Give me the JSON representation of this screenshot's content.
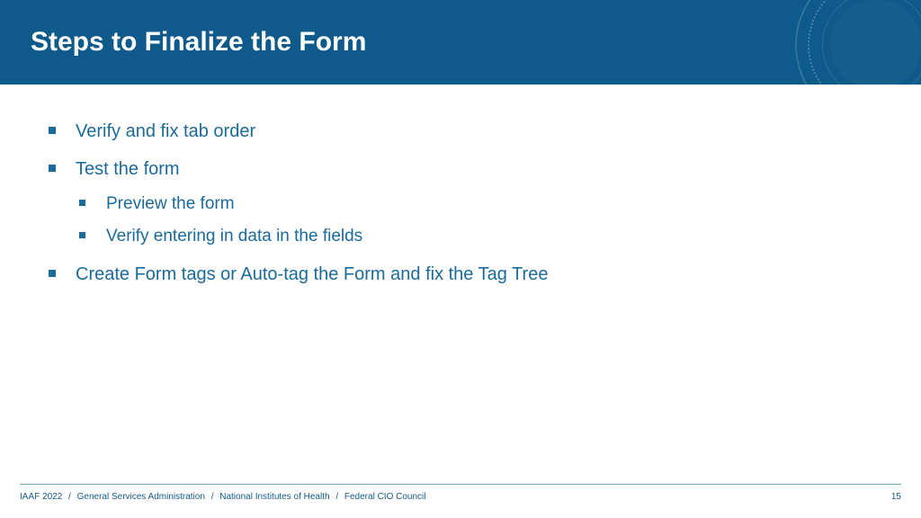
{
  "header": {
    "title": "Steps to Finalize the Form"
  },
  "bullets": {
    "item1": "Verify and fix tab order",
    "item2": "Test the form",
    "item2_sub1": "Preview the form",
    "item2_sub2": "Verify entering in data in the fields",
    "item3": "Create Form tags or Auto-tag the Form and fix the Tag Tree"
  },
  "footer": {
    "part1": "IAAF 2022",
    "part2": "General Services Administration",
    "part3": "National Institutes of Health",
    "part4": "Federal CIO Council",
    "sep": "/",
    "page": "15"
  }
}
